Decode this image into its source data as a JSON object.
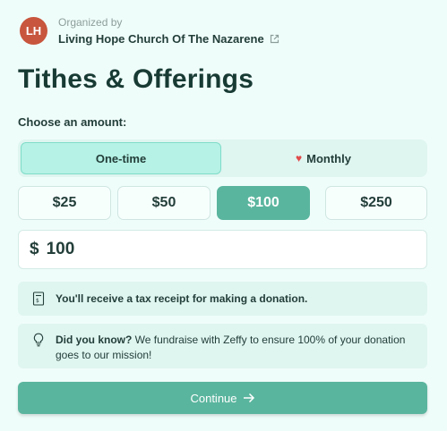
{
  "organizer": {
    "initials": "LH",
    "caption": "Organized by",
    "name": "Living Hope Church Of The Nazarene",
    "link_icon": "external-link-icon"
  },
  "page_title": "Tithes & Offerings",
  "amount": {
    "label": "Choose an amount:",
    "frequency": {
      "options": [
        "One-time",
        "Monthly"
      ],
      "selected": "One-time",
      "monthly_icon": "heart-icon"
    },
    "presets": [
      "$25",
      "$50",
      "$100",
      "$250"
    ],
    "selected_preset": "$100",
    "currency_symbol": "$",
    "value": "100"
  },
  "notices": {
    "receipt": {
      "icon": "receipt-icon",
      "text": "You'll receive a tax receipt for making a donation."
    },
    "tip": {
      "icon": "lightbulb-icon",
      "lead": "Did you know?",
      "text": " We fundraise with Zeffy to ensure 100% of your donation goes to our mission!"
    }
  },
  "continue_label": "Continue",
  "colors": {
    "accent": "#5ab59e",
    "background": "#effdfa",
    "avatar": "#c8553d",
    "heart": "#e04a4a"
  }
}
